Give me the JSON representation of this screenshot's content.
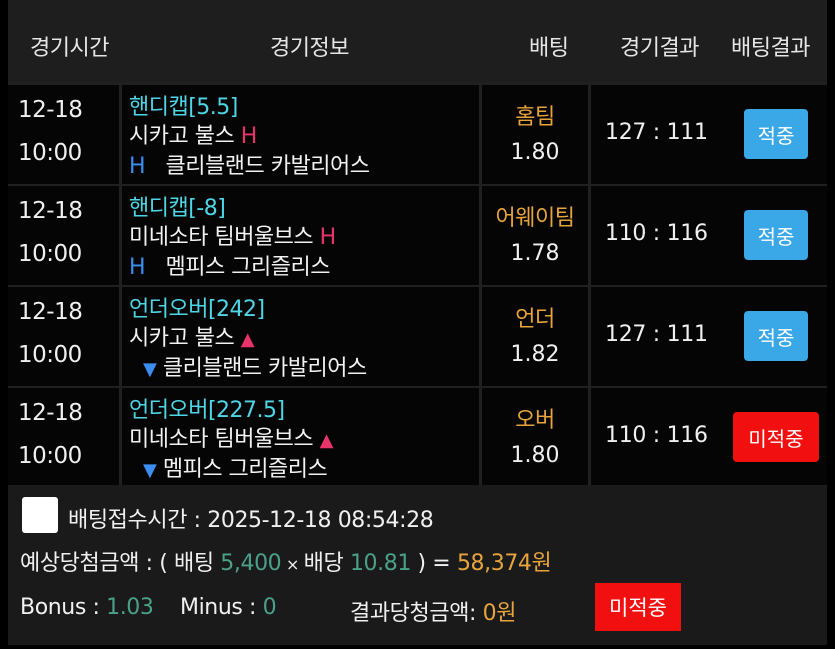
{
  "header": {
    "col_time": "경기시간",
    "col_info": "경기정보",
    "col_bet": "배팅",
    "col_score": "경기결과",
    "col_result": "배팅결과"
  },
  "rows": [
    {
      "date": "12-18",
      "time": "10:00",
      "market": "핸디캡[5.5]",
      "home": "시카고 불스",
      "home_mark": "H",
      "away_mark": "H",
      "away": "클리블랜드 카발리어스",
      "bet_type": "홈팀",
      "odds": "1.80",
      "score": "127 : 111",
      "result": "적중",
      "status": "win"
    },
    {
      "date": "12-18",
      "time": "10:00",
      "market": "핸디캡[-8]",
      "home": "미네소타 팀버울브스",
      "home_mark": "H",
      "away_mark": "H",
      "away": "멤피스 그리즐리스",
      "bet_type": "어웨이팀",
      "odds": "1.78",
      "score": "110 : 116",
      "result": "적중",
      "status": "win"
    },
    {
      "date": "12-18",
      "time": "10:00",
      "market": "언더오버[242]",
      "home": "시카고 불스",
      "home_mark": "▲",
      "away_mark": "▼",
      "away": "클리블랜드 카발리어스",
      "bet_type": "언더",
      "odds": "1.82",
      "score": "127 : 111",
      "result": "적중",
      "status": "win"
    },
    {
      "date": "12-18",
      "time": "10:00",
      "market": "언더오버[227.5]",
      "home": "미네소타 팀버울브스",
      "home_mark": "▲",
      "away_mark": "▼",
      "away": "멤피스 그리즐리스",
      "bet_type": "오버",
      "odds": "1.80",
      "score": "110 : 116",
      "result": "미적중",
      "status": "lose"
    }
  ],
  "footer": {
    "received_label": "배팅접수시간 : ",
    "received_value": "2025-12-18 08:54:28",
    "expected_label": "예상당첨금액 : ( 배팅 ",
    "stake": "5,400",
    "times": " × ",
    "odds_label": "배당 ",
    "total_odds": "10.81",
    "equals": " ) = ",
    "payout": "58,374원",
    "bonus_label": "Bonus : ",
    "bonus_value": "1.03",
    "minus_label": "Minus : ",
    "minus_value": "0",
    "final_label": "결과당청금액: ",
    "final_value": "0원",
    "final_status": "미적중"
  },
  "colors": {
    "market": "#4fd6e6",
    "bet_type": "#e7a43d",
    "win": "#3aa7e6",
    "lose": "#f20f0f",
    "mark_red": "#e8336b",
    "mark_blue": "#3b8ef0",
    "green_value": "#4aa18a"
  }
}
